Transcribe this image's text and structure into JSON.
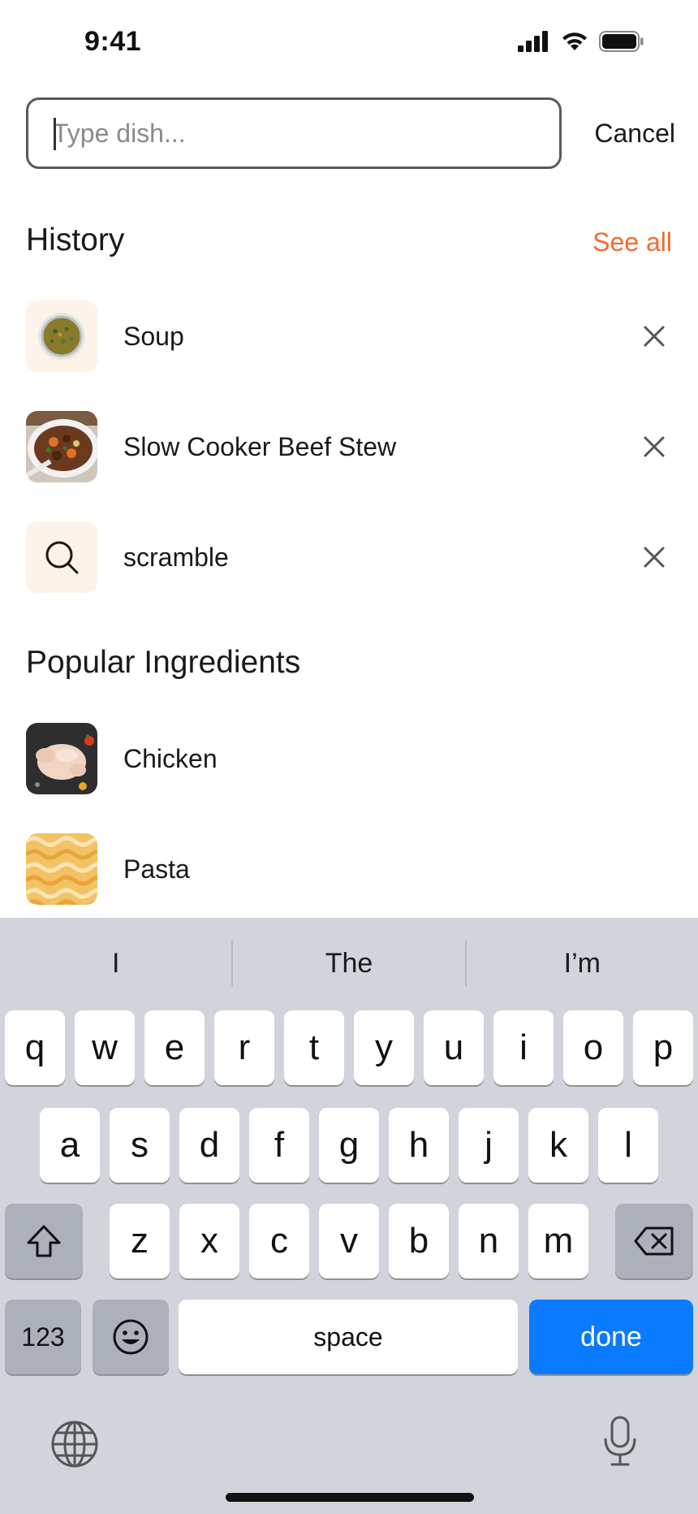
{
  "status_bar": {
    "time": "9:41"
  },
  "search": {
    "placeholder": "Type dish...",
    "value": "",
    "cancel_label": "Cancel"
  },
  "history": {
    "title": "History",
    "see_all_label": "See all",
    "items": [
      {
        "label": "Soup",
        "thumb": "soup-image"
      },
      {
        "label": "Slow Cooker Beef Stew",
        "thumb": "beef-stew-image"
      },
      {
        "label": "scramble",
        "thumb": "search-icon"
      }
    ]
  },
  "popular": {
    "title": "Popular Ingredients",
    "items": [
      {
        "label": "Chicken",
        "thumb": "chicken-image"
      },
      {
        "label": "Pasta",
        "thumb": "pasta-image"
      }
    ]
  },
  "keyboard": {
    "suggestions": [
      "I",
      "The",
      "I’m"
    ],
    "row1": [
      "q",
      "w",
      "e",
      "r",
      "t",
      "y",
      "u",
      "i",
      "o",
      "p"
    ],
    "row2": [
      "a",
      "s",
      "d",
      "f",
      "g",
      "h",
      "j",
      "k",
      "l"
    ],
    "row3": [
      "z",
      "x",
      "c",
      "v",
      "b",
      "n",
      "m"
    ],
    "numbers_label": "123",
    "space_label": "space",
    "done_label": "done"
  },
  "colors": {
    "accent": "#f26a2e",
    "done_key": "#0a7aff",
    "keyboard_bg": "#d1d4db",
    "thumb_bg": "#fdf3e8"
  }
}
